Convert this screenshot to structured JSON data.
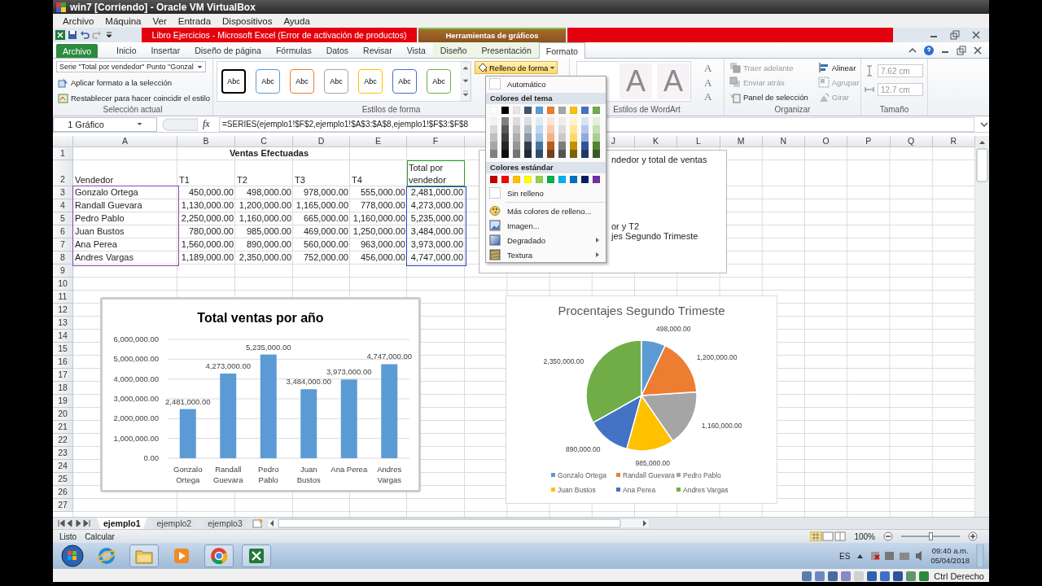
{
  "window": {
    "title": "win7 [Corriendo] - Oracle VM VirtualBox"
  },
  "vm_menu": [
    "Archivo",
    "Máquina",
    "Ver",
    "Entrada",
    "Dispositivos",
    "Ayuda"
  ],
  "excel": {
    "title": "Libro Ejercicios  -  Microsoft Excel (Error de activación de productos)",
    "context_title": "Herramientas de gráficos"
  },
  "ribbon_tabs": [
    {
      "label": "Archivo",
      "kind": "file",
      "selected": false
    },
    {
      "label": "Inicio",
      "kind": "plain",
      "selected": false
    },
    {
      "label": "Insertar",
      "kind": "plain",
      "selected": false
    },
    {
      "label": "Diseño de página",
      "kind": "plain",
      "selected": false
    },
    {
      "label": "Fórmulas",
      "kind": "plain",
      "selected": false
    },
    {
      "label": "Datos",
      "kind": "plain",
      "selected": false
    },
    {
      "label": "Revisar",
      "kind": "plain",
      "selected": false
    },
    {
      "label": "Vista",
      "kind": "plain",
      "selected": false
    },
    {
      "label": "Diseño",
      "kind": "context",
      "selected": false
    },
    {
      "label": "Presentación",
      "kind": "context",
      "selected": false
    },
    {
      "label": "Formato",
      "kind": "context",
      "selected": true
    }
  ],
  "ribbon": {
    "current_selection": {
      "label": "Selección actual",
      "element": "Serie \"Total por vendedor\" Punto \"Gonzal",
      "commands": [
        "Aplicar formato a la selección",
        "Restablecer para hacer coincidir el estilo"
      ]
    },
    "shape_styles": {
      "label": "Estilos de forma",
      "styles": [
        {
          "text": "Abc",
          "color": "#000000"
        },
        {
          "text": "Abc",
          "color": "#5b9bd5"
        },
        {
          "text": "Abc",
          "color": "#ed7d31"
        },
        {
          "text": "Abc",
          "color": "#a5a5a5"
        },
        {
          "text": "Abc",
          "color": "#ffc000"
        },
        {
          "text": "Abc",
          "color": "#4472c4"
        },
        {
          "text": "Abc",
          "color": "#70ad47"
        }
      ],
      "fill_button": {
        "label": "Relleno de forma",
        "open": true
      }
    },
    "wordart": {
      "label": "Estilos de WordArt",
      "styles": [
        "A",
        "A"
      ],
      "buttons": [
        "A",
        "A",
        "A"
      ]
    },
    "arrange": {
      "label": "Organizar",
      "commands": [
        {
          "label": "Traer adelante",
          "disabled": true
        },
        {
          "label": "Enviar atrás",
          "disabled": true
        },
        {
          "label": "Panel de selección",
          "disabled": false
        },
        {
          "label": "Alinear",
          "disabled": false
        },
        {
          "label": "Agrupar",
          "disabled": true
        },
        {
          "label": "Girar",
          "disabled": true
        }
      ]
    },
    "size": {
      "label": "Tamaño",
      "fields": [
        "7.62 cm",
        "12.7 cm"
      ]
    }
  },
  "formula_bar": {
    "name_box": "1 Gráfico",
    "fx": "fx",
    "formula": "=SERIES(ejemplo1!$F$2,ejemplo1!$A$3:$A$8,ejemplo1!$F$3:$F$8"
  },
  "fill_menu": {
    "automatic": "Automático",
    "theme_heading": "Colores del tema",
    "theme_colors": [
      {
        "color": "#ffffff"
      },
      {
        "color": "#000000"
      },
      {
        "color": "#e7e6e6"
      },
      {
        "color": "#44546a"
      },
      {
        "color": "#5b9bd5"
      },
      {
        "color": "#ed7d31"
      },
      {
        "color": "#a5a5a5"
      },
      {
        "color": "#ffc000"
      },
      {
        "color": "#4472c4"
      },
      {
        "color": "#70ad47"
      }
    ],
    "standard_heading": "Colores estándar",
    "standard_colors": [
      {
        "color": "#c00000"
      },
      {
        "color": "#ff0000"
      },
      {
        "color": "#ffc000"
      },
      {
        "color": "#ffff00"
      },
      {
        "color": "#92d050"
      },
      {
        "color": "#00b050"
      },
      {
        "color": "#00b0f0"
      },
      {
        "color": "#0070c0"
      },
      {
        "color": "#002060"
      },
      {
        "color": "#7030a0"
      }
    ],
    "no_fill": "Sin relleno",
    "items": [
      {
        "label": "Más colores de relleno...",
        "kind": "palette",
        "submenu": false
      },
      {
        "label": "Imagen...",
        "kind": "picture",
        "submenu": false
      },
      {
        "label": "Degradado",
        "kind": "gradient",
        "submenu": true
      },
      {
        "label": "Textura",
        "kind": "texture",
        "submenu": true
      }
    ]
  },
  "sheet": {
    "columns_left": [
      "A",
      "B",
      "C",
      "D",
      "E",
      "F"
    ],
    "columns_right": [
      "J",
      "K",
      "L",
      "M",
      "N",
      "O",
      "P",
      "Q",
      "R"
    ],
    "row_numbers": [
      "1",
      "2",
      "3",
      "4",
      "5",
      "6",
      "7",
      "8",
      "9",
      "10",
      "11",
      "12",
      "13",
      "14",
      "15",
      "16",
      "17",
      "18",
      "19",
      "20",
      "21",
      "22",
      "23",
      "24",
      "25",
      "26",
      "27"
    ],
    "title": "Ventas Efectuadas",
    "header": [
      "Vendedor",
      "T1",
      "T2",
      "T3",
      "T4",
      "Total por vendedor"
    ],
    "rows": [
      [
        "Gonzalo Ortega",
        "450,000.00",
        "498,000.00",
        "978,000.00",
        "555,000.00",
        "2,481,000.00"
      ],
      [
        "Randall Guevara",
        "1,130,000.00",
        "1,200,000.00",
        "1,165,000.00",
        "778,000.00",
        "4,273,000.00"
      ],
      [
        "Pedro Pablo",
        "2,250,000.00",
        "1,160,000.00",
        "665,000.00",
        "1,160,000.00",
        "5,235,000.00"
      ],
      [
        "Juan Bustos",
        "780,000.00",
        "985,000.00",
        "469,000.00",
        "1,250,000.00",
        "3,484,000.00"
      ],
      [
        "Ana Perea",
        "1,560,000.00",
        "890,000.00",
        "560,000.00",
        "963,000.00",
        "3,973,000.00"
      ],
      [
        "Andres Vargas",
        "1,189,000.00",
        "2,350,000.00",
        "752,000.00",
        "456,000.00",
        "4,747,000.00"
      ]
    ],
    "textbox": [
      "ndedor y total de ventas",
      "or y T2",
      "jes Segundo Trimeste"
    ],
    "bar_chart": {
      "chart_data": {
        "type": "bar",
        "title": "Total ventas por año",
        "categories": [
          "Gonzalo Ortega",
          "Randall Guevara",
          "Pedro Pablo",
          "Juan Bustos",
          "Ana Perea",
          "Andres Vargas"
        ],
        "series": [
          {
            "color": "#5b9bd5",
            "values": [
              2481000,
              4273000,
              5235000,
              3484000,
              3973000,
              4747000
            ]
          }
        ],
        "ylim": [
          0,
          6000000
        ],
        "grid": true,
        "yticks": [
          {
            "value": 0,
            "label": "0.00"
          },
          {
            "value": 1000000,
            "label": "1,000,000.00"
          },
          {
            "value": 2000000,
            "label": "2,000,000.00"
          },
          {
            "value": 3000000,
            "label": "3,000,000.00"
          },
          {
            "value": 4000000,
            "label": "4,000,000.00"
          },
          {
            "value": 5000000,
            "label": "5,000,000.00"
          },
          {
            "value": 6000000,
            "label": "6,000,000.00"
          }
        ],
        "value_labels": [
          "2,481,000.00",
          "4,273,000.00",
          "5,235,000.00",
          "3,484,000.00",
          "3,973,000.00",
          "4,747,000.00"
        ]
      }
    },
    "pie_chart": {
      "chart_data": {
        "type": "pie",
        "title": "Procentajes Segundo Trimeste",
        "categories": [
          "Gonzalo Ortega",
          "Randall Guevara",
          "Pedro Pablo",
          "Juan Bustos",
          "Ana Perea",
          "Andres Vargas"
        ],
        "colors": [
          "#5b9bd5",
          "#ed7d31",
          "#a5a5a5",
          "#ffc000",
          "#4472c4",
          "#70ad47"
        ],
        "series": [
          {
            "values": [
              7.03,
              16.94,
              16.38,
              13.91,
              12.57,
              33.17
            ]
          }
        ],
        "value_labels": [
          "498,000.00",
          "1,200,000.00",
          "1,160,000.00",
          "985,000.00",
          "890,000.00",
          "2,350,000.00"
        ],
        "legend": "bottom"
      }
    }
  },
  "sheet_tabs": [
    {
      "label": "ejemplo1",
      "selected": true
    },
    {
      "label": "ejemplo2",
      "selected": false
    },
    {
      "label": "ejemplo3",
      "selected": false
    }
  ],
  "status_bar": {
    "mode": "Listo",
    "calc": "Calcular",
    "zoom": "100%",
    "zoom_slider": {
      "level": 0.5
    }
  },
  "taskbar": {
    "language": "ES",
    "time": "09:40 a.m.",
    "date": "05/04/2018"
  },
  "vm_status": {
    "host_key": "Ctrl Derecho"
  }
}
